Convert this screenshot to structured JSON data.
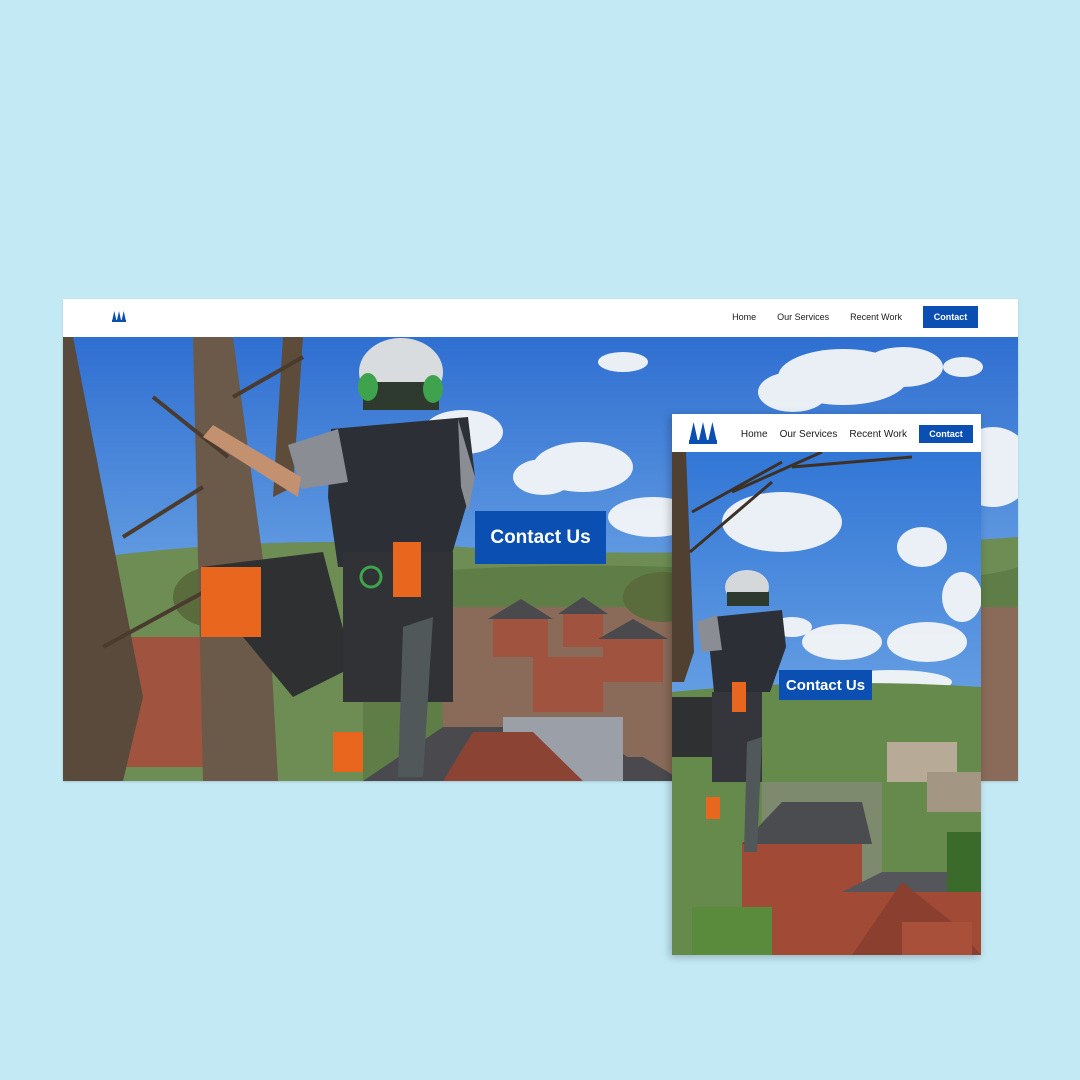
{
  "brand": {
    "logo_icon": "three-trees-icon",
    "color": "#0b4fb3"
  },
  "nav": {
    "home": "Home",
    "services": "Our Services",
    "work": "Recent Work",
    "contact": "Contact"
  },
  "hero": {
    "cta_label": "Contact Us"
  },
  "colors": {
    "page_bg": "#c3e9f5",
    "accent": "#0b4fb3"
  }
}
